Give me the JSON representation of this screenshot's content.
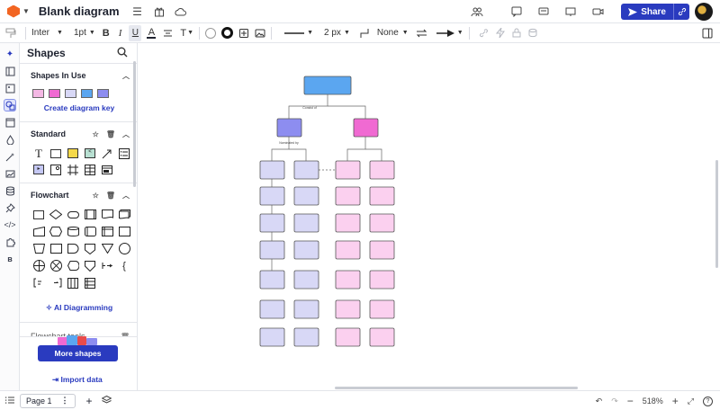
{
  "header": {
    "title": "Blank diagram",
    "share_label": "Share"
  },
  "format_toolbar": {
    "font": "Inter",
    "font_size": "1pt",
    "bold": "B",
    "italic": "I",
    "text_color": "A",
    "text_style": "T",
    "line_width": "2 px",
    "line_start": "None"
  },
  "shapes_panel": {
    "title": "Shapes",
    "shapes_in_use": {
      "label": "Shapes In Use",
      "swatches": [
        "#f4b8e4",
        "#f06ad2",
        "#d8d8f6",
        "#5ba6f0",
        "#8d8df0"
      ],
      "create_key_label": "Create diagram key"
    },
    "standard": {
      "label": "Standard"
    },
    "flowchart": {
      "label": "Flowchart"
    },
    "ai_label": "AI Diagramming",
    "flowchart_tools_label": "Flowchart tools",
    "more_shapes_label": "More shapes",
    "import_label": "Import data"
  },
  "footer": {
    "page_label": "Page 1",
    "zoom": "518%"
  },
  "diagram": {
    "edge_labels": [
      "Consist of",
      "Nominated by"
    ],
    "colors": {
      "root": "#5ba6f0",
      "purple": "#8d8df0",
      "magenta": "#f06ad2",
      "lavender": "#d8d8f6",
      "pink": "#fbd0ef"
    }
  }
}
